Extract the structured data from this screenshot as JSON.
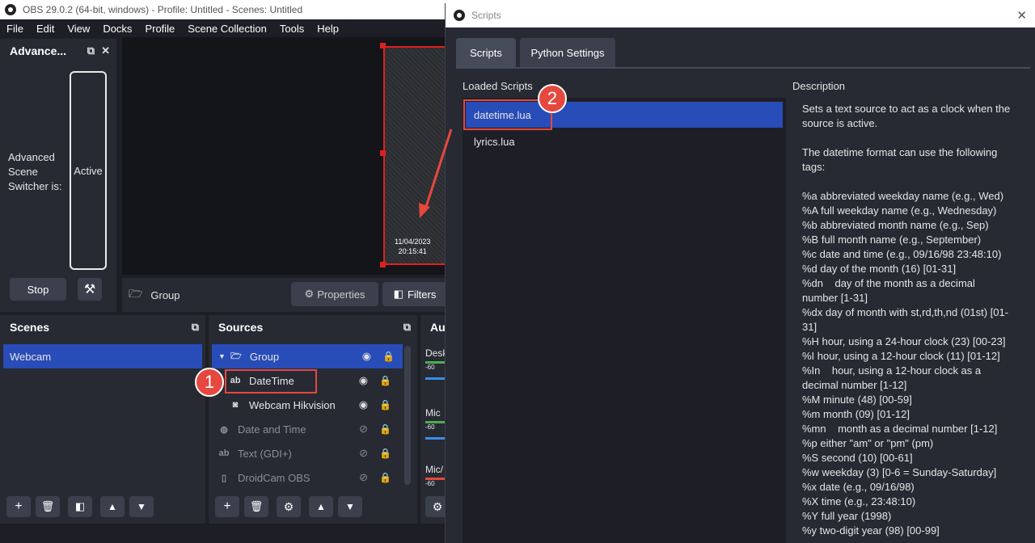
{
  "obs": {
    "title": "OBS 29.0.2 (64-bit, windows) - Profile: Untitled - Scenes: Untitled",
    "menu": [
      "File",
      "Edit",
      "View",
      "Docks",
      "Profile",
      "Scene Collection",
      "Tools",
      "Help"
    ]
  },
  "preview": {
    "datetime_line1": "11/04/2023",
    "datetime_line2": "20:15:41"
  },
  "advanced_dock": {
    "title": "Advance...",
    "status_label": "Advanced Scene Switcher is:",
    "status_value": "Active",
    "stop_label": "Stop"
  },
  "source_bar": {
    "name": "Group",
    "properties_label": "Properties",
    "filters_label": "Filters"
  },
  "scenes": {
    "title": "Scenes",
    "items": [
      "Webcam"
    ]
  },
  "sources": {
    "title": "Sources",
    "items": [
      {
        "label": "Group",
        "icon": "folder-icon",
        "visible": true
      },
      {
        "label": "DateTime",
        "icon": "text-icon",
        "visible": true
      },
      {
        "label": "Webcam Hikvision",
        "icon": "camera-icon",
        "visible": true
      },
      {
        "label": "Date and Time",
        "icon": "globe-icon",
        "visible": false
      },
      {
        "label": "Text (GDI+)",
        "icon": "text-icon",
        "visible": false
      },
      {
        "label": "DroidCam OBS",
        "icon": "file-icon",
        "visible": false
      }
    ]
  },
  "audio": {
    "title": "Au",
    "channels": [
      {
        "label": "Desk",
        "scale": "-60"
      },
      {
        "label": "Mic",
        "scale": "-60"
      },
      {
        "label": "Mic/",
        "scale": "-60"
      }
    ]
  },
  "scripts_window": {
    "title": "Scripts",
    "tabs": [
      "Scripts",
      "Python Settings"
    ],
    "loaded_label": "Loaded Scripts",
    "scripts": [
      "datetime.lua",
      "lyrics.lua"
    ],
    "description_label": "Description",
    "description": "Sets a text source to act as a clock when the source is active.\n\nThe datetime format can use the following tags:\n\n%a abbreviated weekday name (e.g., Wed)\n%A full weekday name (e.g., Wednesday)\n%b abbreviated month name (e.g., Sep)\n%B full month name (e.g., September)\n%c date and time (e.g., 09/16/98 23:48:10)\n%d day of the month (16) [01-31]\n%dn    day of the month as a decimal number [1-31]\n%dx day of month with st,rd,th,nd (01st) [01-31]\n%H hour, using a 24-hour clock (23) [00-23]\n%I hour, using a 12-hour clock (11) [01-12]\n%In    hour, using a 12-hour clock as a decimal number [1-12]\n%M minute (48) [00-59]\n%m month (09) [01-12]\n%mn    month as a decimal number [1-12]\n%p either \"am\" or \"pm\" (pm)\n%S second (10) [00-61]\n%w weekday (3) [0-6 = Sunday-Saturday]\n%x date (e.g., 09/16/98)\n%X time (e.g., 23:48:10)\n%Y full year (1998)\n%y two-digit year (98) [00-99]"
  },
  "annotations": {
    "callout1": "1",
    "callout2": "2"
  },
  "colors": {
    "accent": "#284cb8",
    "annotation": "#e5483f",
    "panel": "#272a33"
  }
}
